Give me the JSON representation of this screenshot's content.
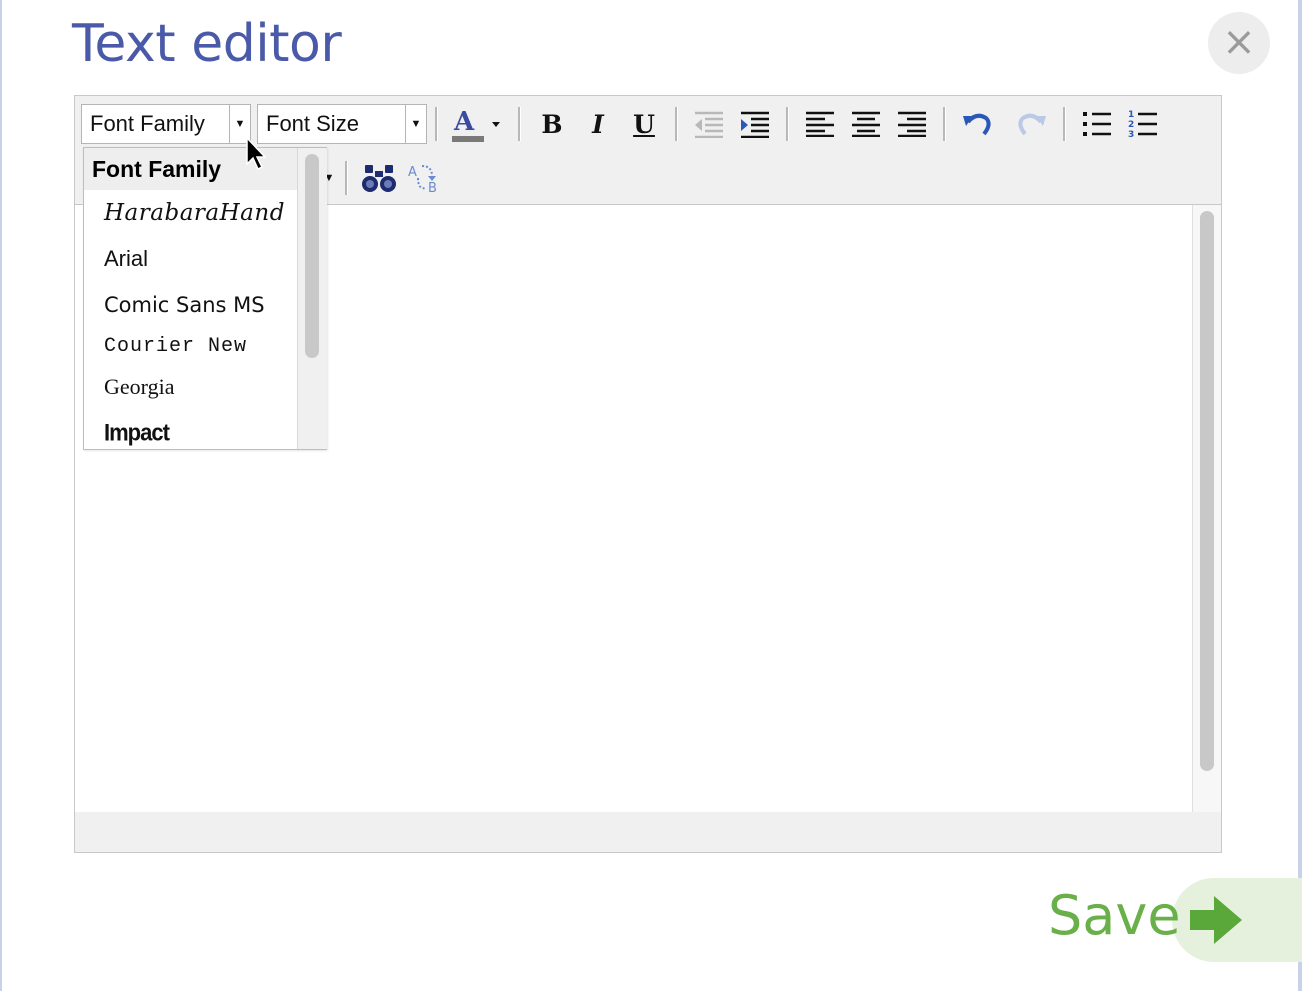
{
  "dialog": {
    "title": "Text editor",
    "close_label": "×"
  },
  "toolbar": {
    "font_family": {
      "value": "Font Family",
      "arrow": "▼"
    },
    "font_size": {
      "value": "Font Size",
      "arrow": "▼"
    },
    "bold_label": "B",
    "italic_label": "I",
    "underline_label": "U",
    "small_arrow": "▼",
    "text_color": "#4a5aa8"
  },
  "font_dropdown": {
    "header": "Font Family",
    "items": [
      "HarabaraHand",
      "Arial",
      "Comic Sans MS",
      "Courier New",
      "Georgia",
      "Impact"
    ]
  },
  "save": {
    "label": "Save",
    "color": "#6ab04a"
  }
}
